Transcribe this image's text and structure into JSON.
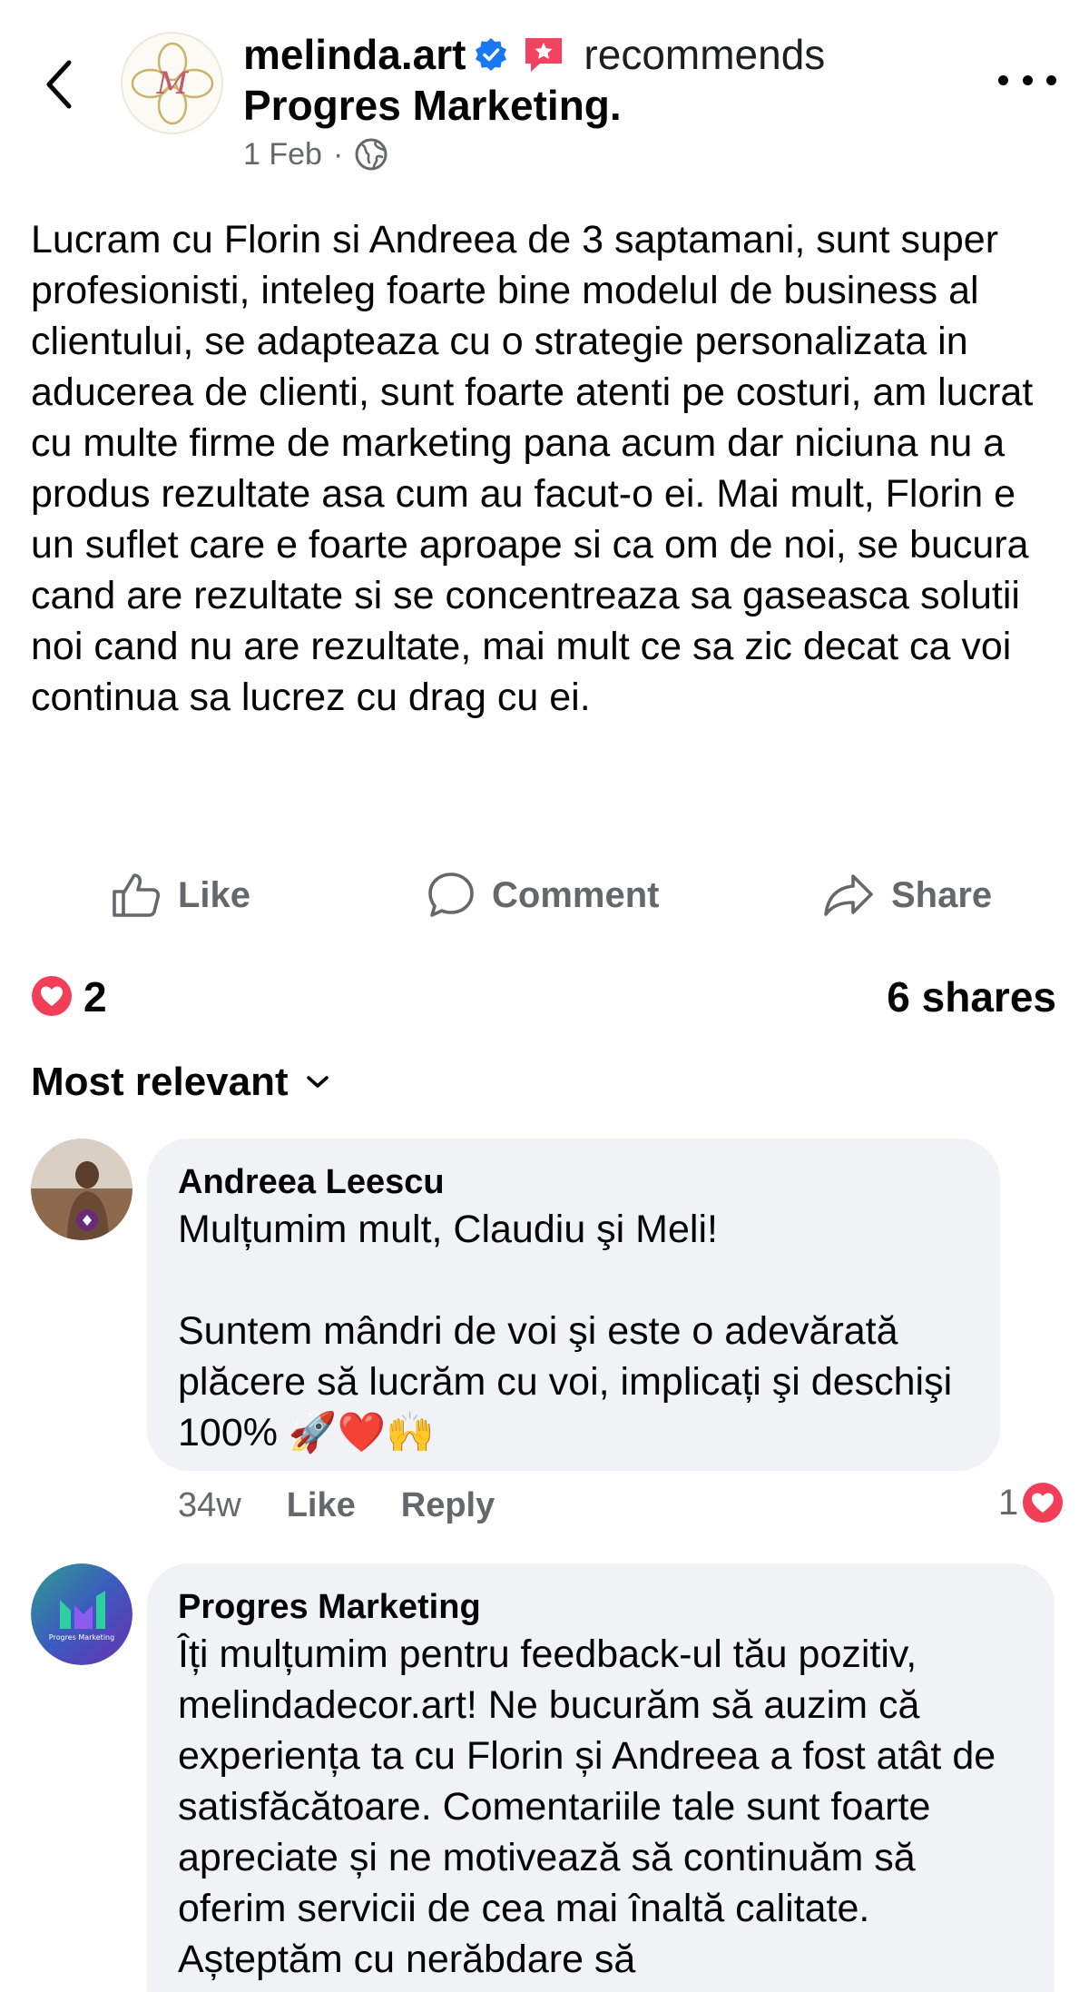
{
  "header": {
    "author": "melinda.art",
    "recommends_label": "recommends",
    "page_name": "Progres Marketing.",
    "date": "1 Feb",
    "separator": "·"
  },
  "post": {
    "text": "Lucram cu Florin si Andreea de 3 saptamani, sunt super profesionisti, inteleg foarte bine modelul de business al clientului, se adapteaza cu o strategie personalizata in aducerea de clienti, sunt foarte atenti pe costuri, am lucrat cu multe firme de marketing pana acum dar niciuna nu a produs rezultate asa cum au facut-o ei. Mai mult, Florin e un suflet care e foarte aproape si ca om de noi, se bucura cand are rezultate si se concentreaza sa gaseasca solutii noi cand nu are rezultate, mai mult ce sa zic decat ca voi continua sa lucrez cu drag cu ei."
  },
  "actions": {
    "like": "Like",
    "comment": "Comment",
    "share": "Share"
  },
  "stats": {
    "reactions": "2",
    "shares": "6 shares"
  },
  "sort": {
    "label": "Most relevant"
  },
  "comments": [
    {
      "author": "Andreea Leescu",
      "text": "Mulțumim mult, Claudiu şi Meli!\n\nSuntem mândri de voi şi este o adevărată plăcere să lucrăm cu voi, implicați şi deschişi 100% 🚀❤️🙌",
      "age": "34w",
      "like": "Like",
      "reply": "Reply",
      "reactions": "1"
    },
    {
      "author": "Progres Marketing",
      "text": "Îți mulțumim pentru feedback-ul tău pozitiv, melindadecor.art! Ne bucurăm să auzim că experiența ta cu Florin și Andreea a fost atât de satisfăcătoare. Comentariile tale sunt foarte apreciate și ne motivează să continuăm să oferim servicii de cea mai înaltă calitate. Așteptăm cu nerăbdare să",
      "avatar_text": "Progres Marketing"
    }
  ],
  "colors": {
    "primary_text": "#050505",
    "secondary_text": "#65676b",
    "bubble_bg": "#f0f2f5",
    "verified_blue": "#1877f2",
    "heart_red": "#f33e58"
  }
}
